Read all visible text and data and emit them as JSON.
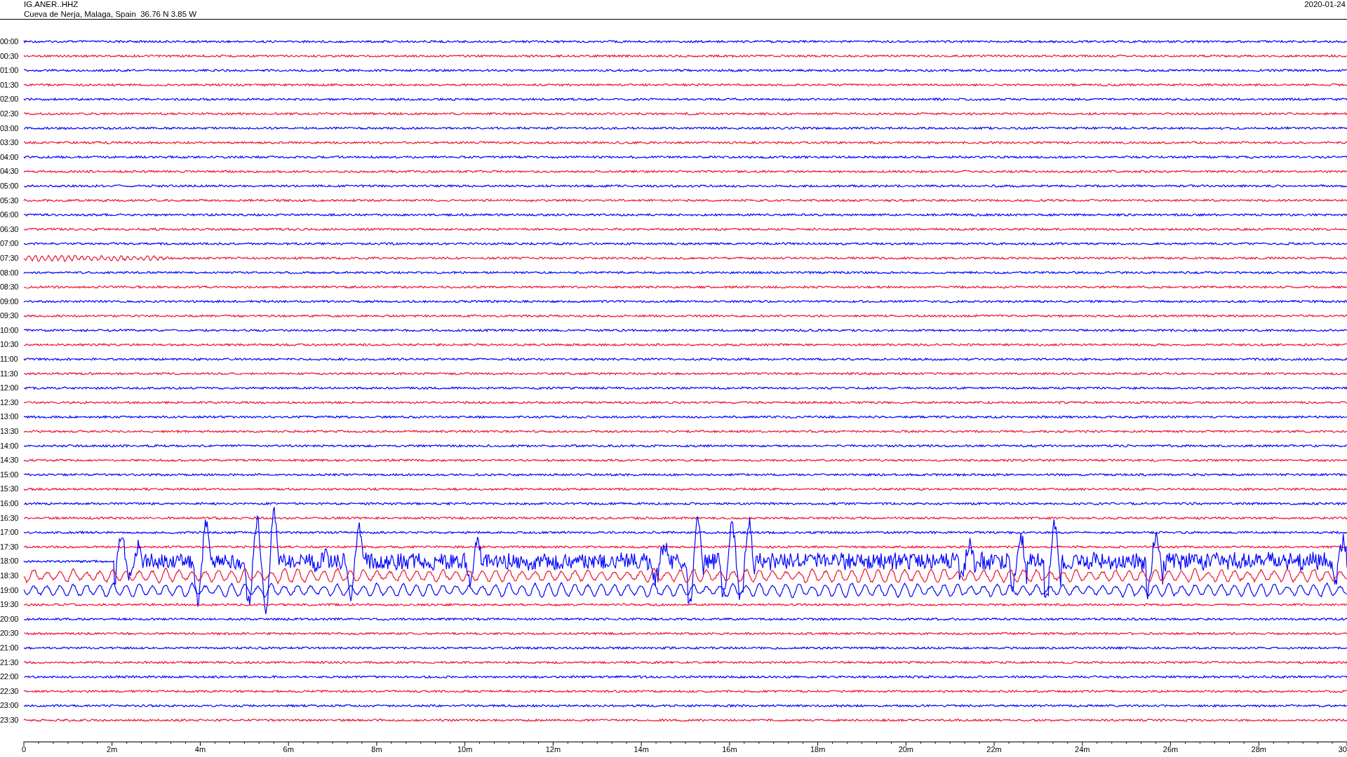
{
  "header": {
    "station": "IG.ANER..HHZ",
    "location": "Cueva de Nerja, Malaga, Spain  36.76 N 3.85 W",
    "date": "2020-01-24"
  },
  "rows": [
    {
      "time": "00:00",
      "color": "#0000ff",
      "kind": "quiet"
    },
    {
      "time": "00:30",
      "color": "#ee1133",
      "kind": "quiet"
    },
    {
      "time": "01:00",
      "color": "#0000ff",
      "kind": "quiet"
    },
    {
      "time": "01:30",
      "color": "#ee1133",
      "kind": "quiet"
    },
    {
      "time": "02:00",
      "color": "#0000ff",
      "kind": "quiet"
    },
    {
      "time": "02:30",
      "color": "#ee1133",
      "kind": "quiet"
    },
    {
      "time": "03:00",
      "color": "#0000ff",
      "kind": "quiet"
    },
    {
      "time": "03:30",
      "color": "#ee1133",
      "kind": "quiet"
    },
    {
      "time": "04:00",
      "color": "#0000ff",
      "kind": "quiet"
    },
    {
      "time": "04:30",
      "color": "#ee1133",
      "kind": "quiet"
    },
    {
      "time": "05:00",
      "color": "#0000ff",
      "kind": "quiet"
    },
    {
      "time": "05:30",
      "color": "#ee1133",
      "kind": "quiet"
    },
    {
      "time": "06:00",
      "color": "#0000ff",
      "kind": "quiet"
    },
    {
      "time": "06:30",
      "color": "#ee1133",
      "kind": "quiet"
    },
    {
      "time": "07:00",
      "color": "#0000ff",
      "kind": "quiet"
    },
    {
      "time": "07:30",
      "color": "#ee1133",
      "kind": "ripple"
    },
    {
      "time": "08:00",
      "color": "#0000ff",
      "kind": "quiet"
    },
    {
      "time": "08:30",
      "color": "#ee1133",
      "kind": "quiet"
    },
    {
      "time": "09:00",
      "color": "#0000ff",
      "kind": "quiet"
    },
    {
      "time": "09:30",
      "color": "#ee1133",
      "kind": "quiet"
    },
    {
      "time": "10:00",
      "color": "#0000ff",
      "kind": "quiet"
    },
    {
      "time": "10:30",
      "color": "#ee1133",
      "kind": "quiet"
    },
    {
      "time": "11:00",
      "color": "#0000ff",
      "kind": "quiet"
    },
    {
      "time": "11:30",
      "color": "#ee1133",
      "kind": "quiet"
    },
    {
      "time": "12:00",
      "color": "#0000ff",
      "kind": "quiet"
    },
    {
      "time": "12:30",
      "color": "#ee1133",
      "kind": "quiet"
    },
    {
      "time": "13:00",
      "color": "#0000ff",
      "kind": "quiet"
    },
    {
      "time": "13:30",
      "color": "#ee1133",
      "kind": "quiet"
    },
    {
      "time": "14:00",
      "color": "#0000ff",
      "kind": "quiet"
    },
    {
      "time": "14:30",
      "color": "#ee1133",
      "kind": "quiet"
    },
    {
      "time": "15:00",
      "color": "#0000ff",
      "kind": "quiet"
    },
    {
      "time": "15:30",
      "color": "#ee1133",
      "kind": "quiet"
    },
    {
      "time": "16:00",
      "color": "#0000ff",
      "kind": "quiet"
    },
    {
      "time": "16:30",
      "color": "#ee1133",
      "kind": "quiet"
    },
    {
      "time": "17:00",
      "color": "#0000ff",
      "kind": "quiet"
    },
    {
      "time": "17:30",
      "color": "#ee1133",
      "kind": "quiet"
    },
    {
      "time": "18:00",
      "color": "#0000ff",
      "kind": "quake"
    },
    {
      "time": "18:30",
      "color": "#ee1133",
      "kind": "swell"
    },
    {
      "time": "19:00",
      "color": "#0000ff",
      "kind": "swell"
    },
    {
      "time": "19:30",
      "color": "#ee1133",
      "kind": "quiet"
    },
    {
      "time": "20:00",
      "color": "#0000ff",
      "kind": "quiet"
    },
    {
      "time": "20:30",
      "color": "#ee1133",
      "kind": "quiet"
    },
    {
      "time": "21:00",
      "color": "#0000ff",
      "kind": "quiet"
    },
    {
      "time": "21:30",
      "color": "#ee1133",
      "kind": "quiet"
    },
    {
      "time": "22:00",
      "color": "#0000ff",
      "kind": "quiet"
    },
    {
      "time": "22:30",
      "color": "#ee1133",
      "kind": "quiet"
    },
    {
      "time": "23:00",
      "color": "#0000ff",
      "kind": "quiet"
    },
    {
      "time": "23:30",
      "color": "#ee1133",
      "kind": "quiet"
    }
  ],
  "axis": {
    "labels": [
      "0",
      "2m",
      "4m",
      "6m",
      "8m",
      "10m",
      "12m",
      "14m",
      "16m",
      "18m",
      "20m",
      "22m",
      "24m",
      "26m",
      "28m",
      "30"
    ]
  }
}
